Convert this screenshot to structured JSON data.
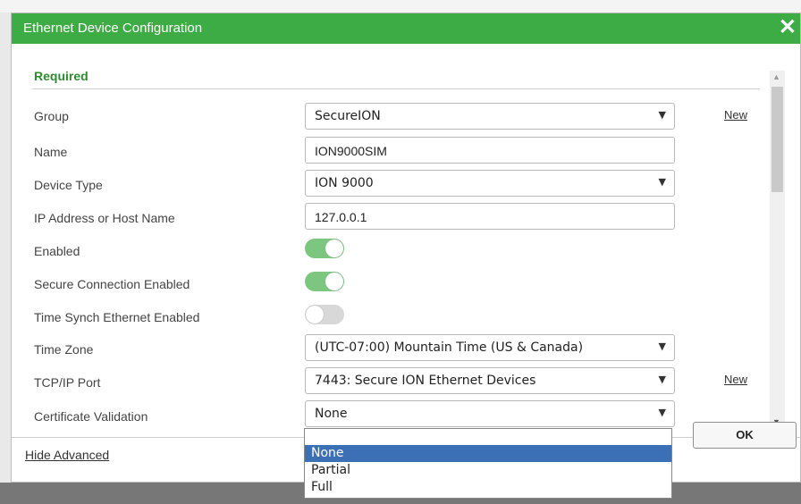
{
  "dialog": {
    "title": "Ethernet Device Configuration",
    "close_glyph": "✕",
    "section_required": "Required",
    "footer": {
      "hide_advanced": "Hide Advanced",
      "ok": "OK"
    }
  },
  "form": {
    "group": {
      "label": "Group",
      "value": "SecureION",
      "new_link": "New"
    },
    "name": {
      "label": "Name",
      "value": "ION9000SIM"
    },
    "device_type": {
      "label": "Device Type",
      "value": "ION 9000"
    },
    "ip": {
      "label": "IP Address or Host Name",
      "value": "127.0.0.1"
    },
    "enabled": {
      "label": "Enabled",
      "state": "on"
    },
    "secure_connection": {
      "label": "Secure Connection Enabled",
      "state": "on"
    },
    "time_synch": {
      "label": "Time Synch Ethernet Enabled",
      "state": "off"
    },
    "time_zone": {
      "label": "Time Zone",
      "value": "(UTC-07:00) Mountain Time (US & Canada)"
    },
    "tcp_port": {
      "label": "TCP/IP Port",
      "value": "7443: Secure ION Ethernet Devices",
      "new_link": "New"
    },
    "cert_validation": {
      "label": "Certificate Validation",
      "value": "None",
      "options": [
        "None",
        "Partial",
        "Full"
      ],
      "selected_option": "None"
    }
  },
  "colors": {
    "titlebar": "#3dac44",
    "required_heading": "#2e8b2e",
    "toggle_on": "#7dc67f",
    "toggle_off": "#d8d8d8",
    "option_highlight": "#3b6fb6"
  },
  "icons": {
    "select_caret": "chevron-down-icon",
    "close": "close-icon",
    "scroll_up": "scroll-up-arrow-icon",
    "scroll_down": "scroll-down-arrow-icon"
  }
}
